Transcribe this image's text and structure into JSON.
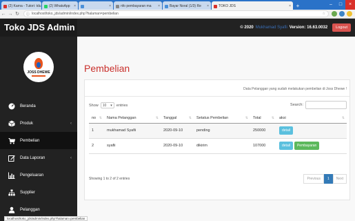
{
  "browser": {
    "tabs": [
      {
        "label": "(2) Karna - Tutori: tdu",
        "color": "#d9302a"
      },
      {
        "label": "(2) WhatsApp",
        "color": "#25d366"
      },
      {
        "label": "",
        "color": "#4a90d9"
      },
      {
        "label": "nfo pembayaran ma",
        "color": "#888888"
      },
      {
        "label": "Bayar Noral (1/3) Re",
        "color": "#4a90d9"
      },
      {
        "label": "TOKO JDS",
        "color": "#d9302a"
      }
    ],
    "url": "localhost/toko_jds/admin/index.php?halaman=pembelian"
  },
  "header": {
    "brand": "Toko JDS Admin",
    "year": "© 2020",
    "user": "Mukhamad Syafii",
    "version": "Version: 16.63.0032",
    "logout": "Logout"
  },
  "sidebar": {
    "logo_text": "JOSS DHEWE",
    "items": [
      {
        "label": "Beranda",
        "icon": "tachometer-icon",
        "caret": false
      },
      {
        "label": "Produk",
        "icon": "cube-icon",
        "caret": true
      },
      {
        "label": "Pembelian",
        "icon": "cart-icon",
        "caret": false,
        "active": true
      },
      {
        "label": "Data Laporan",
        "icon": "edit-icon",
        "caret": true
      },
      {
        "label": "Pengeluaran",
        "icon": "bar-chart-icon",
        "caret": false
      },
      {
        "label": "Supplier",
        "icon": "sitemap-icon",
        "caret": false
      },
      {
        "label": "Pelanggan",
        "icon": "user-icon",
        "caret": false
      }
    ]
  },
  "main": {
    "title": "Pembelian",
    "note": "Data Pelanggan yang sudah melakukan pembelian di Joss Dhewe !",
    "show_label": "Show",
    "entries_value": "10",
    "entries_label": "entries",
    "search_label": "Search:",
    "columns": [
      "no",
      "Nama Pelanggan",
      "Tanggal",
      "Setatus Pembelian",
      "Total",
      "aksi"
    ],
    "rows": [
      {
        "no": "1",
        "nama": "mukhamad Syafii",
        "tanggal": "2020-09-10",
        "status": "pending",
        "total": "250000",
        "actions": [
          "detail"
        ]
      },
      {
        "no": "2",
        "nama": "syafii",
        "tanggal": "2020-09-10",
        "status": "dikirim",
        "total": "107000",
        "actions": [
          "detail",
          "Pembayaran"
        ]
      }
    ],
    "showing": "Showing 1 to 2 of 2 entries",
    "pager": {
      "previous": "Previous",
      "page": "1",
      "next": "Next"
    }
  },
  "statusbar": "localhost/toko_jds/admin/index.php?halaman=pembelian"
}
